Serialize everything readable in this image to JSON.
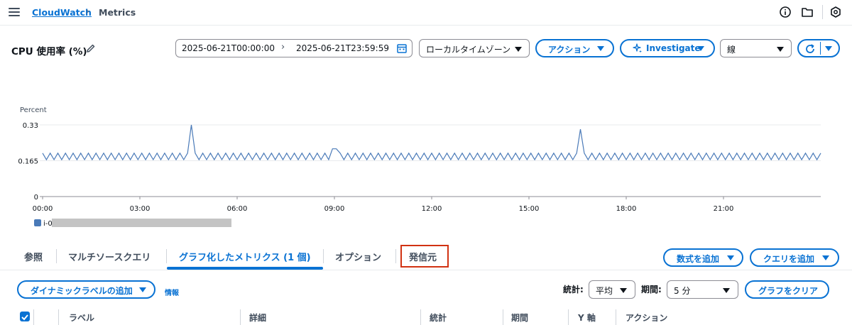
{
  "breadcrumb": {
    "root": "CloudWatch",
    "separator": "›",
    "current": "Metrics"
  },
  "title": "CPU 使用率 (%)",
  "time_range": {
    "start": "2025-06-21T00:00:00",
    "arrow": "›",
    "end": "2025-06-21T23:59:59"
  },
  "timezone": {
    "selected": "ローカルタイムゾーン"
  },
  "buttons": {
    "actions": "アクション",
    "investigate": "Investigate",
    "add_formula": "数式を追加",
    "add_query": "クエリを追加",
    "dynamic_label": "ダイナミックラベルの追加",
    "clear_graph": "グラフをクリア"
  },
  "chart_type": {
    "selected": "線"
  },
  "chart_data": {
    "type": "line",
    "ylabel": "Percent",
    "ylim": [
      0,
      0.33
    ],
    "yticks": [
      "0.33",
      "0.165",
      "0"
    ],
    "xticks": [
      "00:00",
      "03:00",
      "06:00",
      "09:00",
      "12:00",
      "15:00",
      "18:00",
      "21:00"
    ],
    "grid": true,
    "legend_position": "bottom-left",
    "series": [
      {
        "legend_prefix": "i-0",
        "color": "#4a7ab8",
        "baseline": 0.185,
        "amplitude": 0.015,
        "points_per_hour": 8.5,
        "spikes": [
          {
            "x_hours": 4.55,
            "y": 0.33
          },
          {
            "x_hours": 9.0,
            "y": 0.22
          },
          {
            "x_hours": 16.55,
            "y": 0.31
          }
        ]
      }
    ],
    "series_color": "#4a7ab8"
  },
  "tabs": [
    {
      "label": "参照"
    },
    {
      "label": "マルチソースクエリ"
    },
    {
      "label": "グラフ化したメトリクス (1 個)"
    },
    {
      "label": "オプション"
    },
    {
      "label": "発信元"
    }
  ],
  "filters": {
    "info": "情報",
    "statistic_label": "統計:",
    "statistic_value": "平均",
    "period_label": "期間:",
    "period_value": "5 分"
  },
  "table": {
    "headers": [
      "ラベル",
      "詳細",
      "統計",
      "期間",
      "Y 軸",
      "アクション"
    ]
  },
  "colors": {
    "accent": "#0972d3",
    "highlight": "#d13212"
  }
}
